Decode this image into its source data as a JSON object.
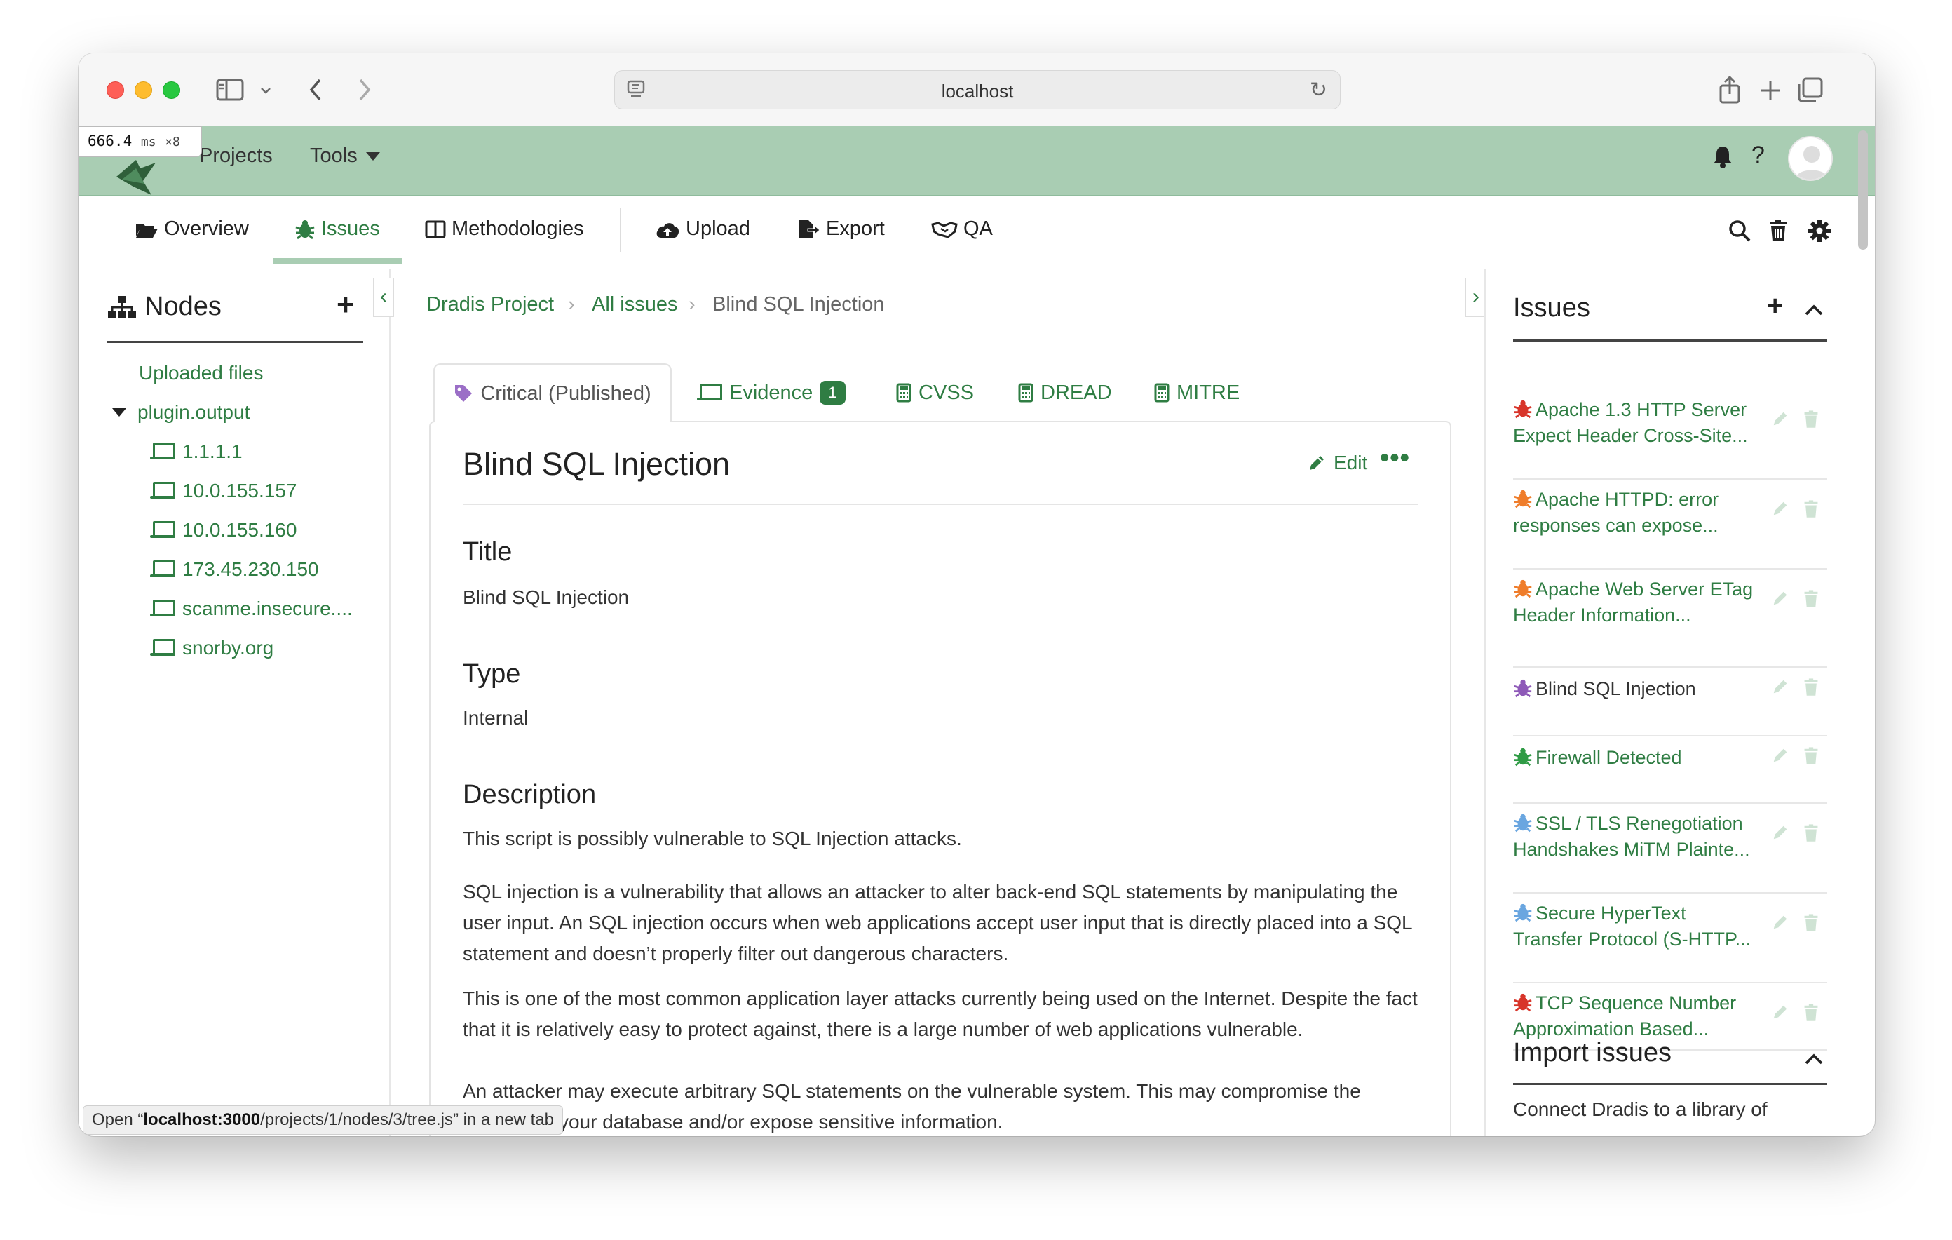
{
  "browser": {
    "url": "localhost"
  },
  "perf": {
    "time": "666.4",
    "unit": "ms",
    "count": "×8"
  },
  "header": {
    "nav": [
      "Projects",
      "Tools"
    ],
    "help": "?"
  },
  "subnav": {
    "items": [
      "Overview",
      "Issues",
      "Methodologies",
      "Upload",
      "Export",
      "QA"
    ],
    "active": "Issues"
  },
  "nodes": {
    "title": "Nodes",
    "uploaded": "Uploaded files",
    "group": "plugin.output",
    "hosts": [
      "1.1.1.1",
      "10.0.155.157",
      "10.0.155.160",
      "173.45.230.150",
      "scanme.insecure....",
      "snorby.org"
    ]
  },
  "breadcrumb": [
    "Dradis Project",
    "All issues",
    "Blind SQL Injection"
  ],
  "tabs": {
    "active": "Critical (Published)",
    "evidence": "Evidence",
    "evidence_count": "1",
    "others": [
      "CVSS",
      "DREAD",
      "MITRE"
    ]
  },
  "issue": {
    "title": "Blind SQL Injection",
    "edit": "Edit",
    "fields": {
      "title_h": "Title",
      "title_v": "Blind SQL Injection",
      "type_h": "Type",
      "type_v": "Internal",
      "desc_h": "Description",
      "desc_p1": "This script is possibly vulnerable to SQL Injection attacks.",
      "desc_p2": "SQL injection is a vulnerability that allows an attacker to alter back-end SQL statements by manipulating the user input. An SQL injection occurs when web applications accept user input that is directly placed into a SQL statement and doesn’t properly filter out dangerous characters.",
      "desc_p3": "This is one of the most common application layer attacks currently being used on the Internet. Despite the fact that it is relatively easy to protect against, there is a large number of web applications vulnerable.",
      "desc_p4": "An attacker may execute arbitrary SQL statements on the vulnerable system. This may compromise the integrity of your database and/or expose sensitive information."
    }
  },
  "issues_panel": {
    "title": "Issues",
    "items": [
      {
        "text": "Apache 1.3 HTTP Server Expect Header Cross-Site...",
        "color": "#d8352a"
      },
      {
        "text": "Apache HTTPD: error responses can expose...",
        "color": "#ef7d2b"
      },
      {
        "text": "Apache Web Server ETag Header Information...",
        "color": "#ef7d2b"
      },
      {
        "text": "Blind SQL Injection",
        "color": "#8e59b8"
      },
      {
        "text": "Firewall Detected",
        "color": "#2f9b45"
      },
      {
        "text": "SSL / TLS Renegotiation Handshakes MiTM Plainte...",
        "color": "#6aa6e0"
      },
      {
        "text": "Secure HyperText Transfer Protocol (S-HTTP...",
        "color": "#6aa6e0"
      },
      {
        "text": "TCP Sequence Number Approximation Based...",
        "color": "#d8352a"
      }
    ],
    "import_title": "Import issues",
    "import_text": "Connect Dradis to a library of"
  },
  "status": {
    "prefix": "Open “",
    "host": "localhost:3000",
    "path": "/projects/1/nodes/3/tree.js",
    "suffix": "” in a new tab"
  },
  "colors": {
    "accent": "#2f7d43",
    "header_bg": "#a9cdb3"
  }
}
